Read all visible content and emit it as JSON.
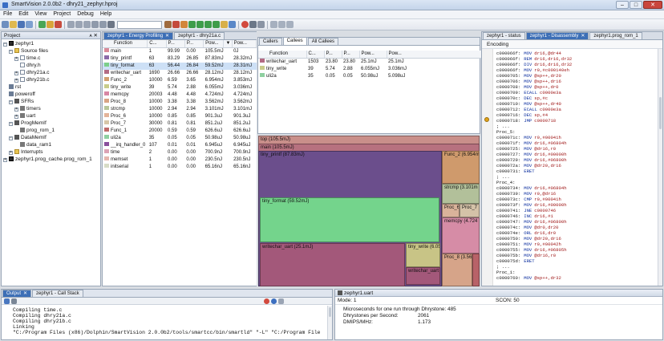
{
  "app": {
    "title": "SmartVision 2.0.0b2 - dhry21_zephyr.hproj"
  },
  "menu": [
    "File",
    "Edit",
    "View",
    "Project",
    "Debug",
    "Help"
  ],
  "project": {
    "header": "Project",
    "root": "zephyr1",
    "source_files": "Source files",
    "files": [
      "time.c",
      "dhry.h",
      "dhry21a.c",
      "dhry21b.c"
    ],
    "rst": "rst",
    "poweroff": "poweroff",
    "sfrs": "SFRs",
    "sfr_items": [
      "timers",
      "uart"
    ],
    "progmem": "ProgMemIf",
    "progmem_item": "prog_rom_1",
    "datamem": "DataMemIf",
    "datamem_item": "data_ram1",
    "interrupts": "Interrupts",
    "cache": "zephyr1.prog_cache.prog_rom_1"
  },
  "energy": {
    "tabs": [
      "zephyr1 - Energy Profiling",
      "zephyr1 - dhry21a.c"
    ],
    "columns": [
      "Function",
      "C...",
      "P...",
      "P...",
      "Pow...",
      "",
      "Pow..."
    ],
    "rows": [
      {
        "name": "main",
        "calls": "1",
        "p1": "99.99",
        "p2": "0.00",
        "pow1": "105.5mJ",
        "pow2": "0J",
        "color": "#d98b9a"
      },
      {
        "name": "tiny_printf",
        "calls": "63",
        "p1": "83.29",
        "p2": "26.85",
        "pow1": "87.83mJ",
        "pow2": "28.32mJ",
        "color": "#8b6aa8"
      },
      {
        "name": "tiny_format",
        "calls": "63",
        "p1": "56.44",
        "p2": "26.84",
        "pow1": "59.52mJ",
        "pow2": "28.31mJ",
        "color": "#7ccf8a"
      },
      {
        "name": "writechar_uart",
        "calls": "1690",
        "p1": "26.66",
        "p2": "26.66",
        "pow1": "28.12mJ",
        "pow2": "28.12mJ",
        "color": "#b36b84"
      },
      {
        "name": "Func_2",
        "calls": "10000",
        "p1": "6.59",
        "p2": "3.65",
        "pow1": "6.954mJ",
        "pow2": "3.853mJ",
        "color": "#d2a070"
      },
      {
        "name": "tiny_write",
        "calls": "39",
        "p1": "5.74",
        "p2": "2.88",
        "pow1": "6.055mJ",
        "pow2": "3.036mJ",
        "color": "#c9cc8a"
      },
      {
        "name": "memcpy",
        "calls": "20003",
        "p1": "4.48",
        "p2": "4.48",
        "pow1": "4.724mJ",
        "pow2": "4.724mJ",
        "color": "#d887a4"
      },
      {
        "name": "Proc_8",
        "calls": "10000",
        "p1": "3.38",
        "p2": "3.38",
        "pow1": "3.562mJ",
        "pow2": "3.562mJ",
        "color": "#d8a485"
      },
      {
        "name": "strcmp",
        "calls": "10000",
        "p1": "2.94",
        "p2": "2.94",
        "pow1": "3.101mJ",
        "pow2": "3.101mJ",
        "color": "#b8c79a"
      },
      {
        "name": "Proc_6",
        "calls": "10000",
        "p1": "0.85",
        "p2": "0.85",
        "pow1": "901.3uJ",
        "pow2": "901.3uJ",
        "color": "#e3b39a"
      },
      {
        "name": "Proc_7",
        "calls": "30000",
        "p1": "0.81",
        "p2": "0.81",
        "pow1": "851.2uJ",
        "pow2": "851.2uJ",
        "color": "#d6c6a8"
      },
      {
        "name": "Func_1",
        "calls": "20000",
        "p1": "0.59",
        "p2": "0.59",
        "pow1": "626.6uJ",
        "pow2": "626.6uJ",
        "color": "#c06b6b"
      },
      {
        "name": "uli2a",
        "calls": "35",
        "p1": "0.05",
        "p2": "0.05",
        "pow1": "50.98uJ",
        "pow2": "50.98uJ",
        "color": "#8fd0a0"
      },
      {
        "name": "__irq_handler_0",
        "calls": "107",
        "p1": "0.01",
        "p2": "0.01",
        "pow1": "6.945uJ",
        "pow2": "6.945uJ",
        "color": "#8a4f9c"
      },
      {
        "name": "time",
        "calls": "2",
        "p1": "0.00",
        "p2": "0.00",
        "pow1": "700.9nJ",
        "pow2": "700.9nJ",
        "color": "#dca3b5"
      },
      {
        "name": "memset",
        "calls": "1",
        "p1": "0.00",
        "p2": "0.00",
        "pow1": "230.5nJ",
        "pow2": "230.5nJ",
        "color": "#e6b6ae"
      },
      {
        "name": "initserial",
        "calls": "1",
        "p1": "0.00",
        "p2": "0.00",
        "pow1": "65.16nJ",
        "pow2": "65.16nJ",
        "color": "#d7dcc6"
      }
    ]
  },
  "callees": {
    "tabs": [
      "Callers",
      "Callees",
      "All Callees"
    ],
    "columns": [
      "Function",
      "C...",
      "P...",
      "P...",
      "Pow...",
      "Pow..."
    ],
    "rows": [
      {
        "name": "writechar_uart",
        "calls": "1503",
        "p1": "23.80",
        "p2": "23.80",
        "pow1": "25.1mJ",
        "pow2": "25.1mJ",
        "color": "#b36b84"
      },
      {
        "name": "tiny_write",
        "calls": "39",
        "p1": "5.74",
        "p2": "2.88",
        "pow1": "6.055mJ",
        "pow2": "3.036mJ",
        "color": "#c9cc8a"
      },
      {
        "name": "uli2a",
        "calls": "35",
        "p1": "0.05",
        "p2": "0.05",
        "pow1": "50.98uJ",
        "pow2": "5.098uJ",
        "color": "#8fd0a0"
      }
    ]
  },
  "treemap": {
    "top": "top (105.5mJ)",
    "main": "main (105.5mJ)",
    "tiny_printf": "tiny_printf (87.83mJ)",
    "tiny_format": "tiny_format (59.52mJ)",
    "writechar": "writechar_uart (25.1mJ)",
    "tiny_write": "tiny_write (6.05",
    "writechar_small": "writechar_uart",
    "func2": "Func_2 (6.954m",
    "strcmp": "strcmp (3.101m",
    "proc6": "Proc_6",
    "proc7": "Proc_7",
    "memcpy": "memcpy (4.724",
    "proc8": "Proc_8 (3.562m",
    "colors": {
      "top": "#c98f8a",
      "main": "#b7717f",
      "tiny_printf": "#6b4e8c",
      "tiny_format": "#74d48c",
      "writechar": "#a3587a",
      "tiny_write": "#c8c486",
      "func2": "#cf9a6c",
      "strcmp": "#b2c09a",
      "proc6": "#d9b29a",
      "proc7": "#d4c2a8",
      "memcpy": "#d68ca6",
      "proc8": "#d6a489",
      "func1": "#b86268"
    }
  },
  "disasm": {
    "tabs": [
      "zephyr1 - status",
      "zephyr1 - Disassembly",
      "zephyr1.prog_rom_1"
    ],
    "encoding": "Encoding",
    "lines": [
      {
        "a": "c000066f:",
        "m": "MOV",
        "o": "dr16,@dr44"
      },
      {
        "a": "c000066f:",
        "m": "REM",
        "o": "dr16,dr16,dr32"
      },
      {
        "a": "c000066f:",
        "m": "DIV",
        "o": "dr16,dr16,dr32"
      },
      {
        "a": "c000066f:",
        "m": "MOV",
        "o": "r0,#c000140eh"
      },
      {
        "a": "c0000705:",
        "m": "MOV",
        "o": "@sp++,dr20"
      },
      {
        "a": "c0000706:",
        "m": "MOV",
        "o": "@sp++,dr16"
      },
      {
        "a": "c0000708:",
        "m": "MOV",
        "o": "@sp++,dr0"
      },
      {
        "a": "c0000709:",
        "m": "ECALL",
        "o": "c0000e3a"
      },
      {
        "a": "c000070c:",
        "m": "DEC",
        "o": "sp,#c"
      },
      {
        "a": "c0000710:",
        "m": "MOV",
        "o": "@sp++,dr40"
      },
      {
        "a": "c0000712:",
        "m": "ECALL",
        "o": "c0000e3a"
      },
      {
        "a": "c0000716:",
        "m": "DEC",
        "o": "sp,#4"
      },
      {
        "a": "c0000718:",
        "m": "JMP",
        "o": "c0000718"
      },
      {
        "l": ";  ..."
      },
      {
        "l": "Proc_5:"
      },
      {
        "a": "c000071c:",
        "m": "MOV",
        "o": "r0,#00041h"
      },
      {
        "a": "c000071f:",
        "m": "MOV",
        "o": "dr16,#06804h"
      },
      {
        "a": "c0000725:",
        "m": "MOV",
        "o": "@dr16,r0"
      },
      {
        "a": "c0000727:",
        "m": "MOV",
        "o": "dr16,#00000h"
      },
      {
        "a": "c0000729:",
        "m": "MOV",
        "o": "dr16,#06800h"
      },
      {
        "a": "c000072a:",
        "m": "MOV",
        "o": "@dr20,dr16"
      },
      {
        "a": "c0000731:",
        "m": "ERET",
        "o": ""
      },
      {
        "l": ";  ..."
      },
      {
        "l": "Proc_4:"
      },
      {
        "a": "c0000734:",
        "m": "MOV",
        "o": "dr16,#06804h"
      },
      {
        "a": "c0000739:",
        "m": "MOV",
        "o": "r0,@dr16"
      },
      {
        "a": "c000073c:",
        "m": "CMP",
        "o": "r0,#00041h"
      },
      {
        "a": "c000073f:",
        "m": "MOV",
        "o": "dr16,#00000h"
      },
      {
        "a": "c0000741:",
        "m": "JNE",
        "o": "c0000746"
      },
      {
        "a": "c0000746:",
        "m": "INC",
        "o": "dr16,#1"
      },
      {
        "a": "c0000747:",
        "m": "MOV",
        "o": "dr16,#06800h"
      },
      {
        "a": "c000074c:",
        "m": "MOV",
        "o": "@dr0,dr20"
      },
      {
        "a": "c000074e:",
        "m": "ORL",
        "o": "dr16,dr0"
      },
      {
        "a": "c0000750:",
        "m": "MOV",
        "o": "@dr20,dr16"
      },
      {
        "a": "c0000751:",
        "m": "MOV",
        "o": "r0,#00042h"
      },
      {
        "a": "c0000755:",
        "m": "MOV",
        "o": "dr16,#06805h"
      },
      {
        "a": "c000075b:",
        "m": "MOV",
        "o": "@dr16,r0"
      },
      {
        "a": "c000075d:",
        "m": "ERET",
        "o": ""
      },
      {
        "l": ";  ..."
      },
      {
        "l": "Proc_1:"
      },
      {
        "a": "c0000760:",
        "m": "MOV",
        "o": "@sp++,dr32"
      }
    ]
  },
  "output": {
    "tabs": [
      "Output",
      "zephyr1 - Call Stack"
    ],
    "lines": [
      "Compiling time.c",
      "Compiling dhry21a.c",
      "Compiling dhry21b.c",
      "Linking",
      "\"C:/Program Files (x86)/Dolphin/SmartVision 2.0.0b2/tools/smartcc/bin/smartld\" \"-L\" \"C:/Program File"
    ]
  },
  "uart": {
    "header": "zephyr1.uart",
    "mode": "Mode: 1",
    "scon": "SCON: 50",
    "lines": [
      {
        "label": "Microseconds for one run through Dhrystone: 485",
        "value": ""
      },
      {
        "label": "Dhrystones per Second:",
        "value": "2061"
      },
      {
        "label": "DMIPS/MHz:",
        "value": "1.173"
      }
    ]
  }
}
